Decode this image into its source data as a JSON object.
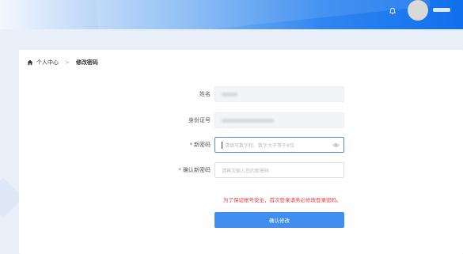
{
  "header": {
    "bell_icon": "bell-icon",
    "avatar_icon": "avatar"
  },
  "breadcrumb": {
    "home_icon": "home-icon",
    "home_label": "个人中心",
    "separator": ">",
    "current_label": "修改密码"
  },
  "form": {
    "name_label": "姓名",
    "id_label": "身份证号",
    "new_password_label": "新密码",
    "new_password_placeholder": "请填写数字和、数字大于等于8位",
    "confirm_label": "确认新密码",
    "confirm_placeholder": "请再次输入您的新密码",
    "required_mark": "*",
    "notice": "为了保证帐号安全，首次登录请务必修改登录密码。",
    "submit_label": "确认修改"
  },
  "colors": {
    "primary": "#3f8ef0",
    "danger": "#e83a3a"
  }
}
